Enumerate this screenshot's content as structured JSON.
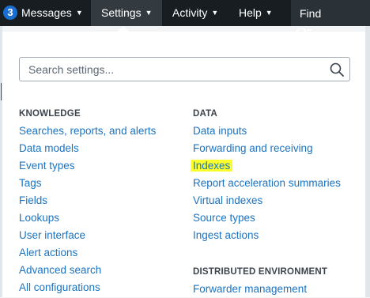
{
  "topbar": {
    "badge_count": "3",
    "nav": [
      {
        "label": "Messages"
      },
      {
        "label": "Settings"
      },
      {
        "label": "Activity"
      },
      {
        "label": "Help"
      }
    ],
    "find_placeholder": "Find"
  },
  "settings_menu": {
    "search_placeholder": "Search settings...",
    "knowledge": {
      "heading": "KNOWLEDGE",
      "items": [
        "Searches, reports, and alerts",
        "Data models",
        "Event types",
        "Tags",
        "Fields",
        "Lookups",
        "User interface",
        "Alert actions",
        "Advanced search",
        "All configurations"
      ]
    },
    "data": {
      "heading": "DATA",
      "items": [
        "Data inputs",
        "Forwarding and receiving",
        "Indexes",
        "Report acceleration summaries",
        "Virtual indexes",
        "Source types",
        "Ingest actions"
      ],
      "highlighted_item": "Indexes"
    },
    "distributed_environment": {
      "heading": "DISTRIBUTED ENVIRONMENT",
      "items": [
        "Forwarder management"
      ]
    }
  },
  "colors": {
    "topbar_bg": "#171d21",
    "badge": "#1a6fd1",
    "link": "#1a73c0",
    "highlight": "#fcff2d"
  }
}
